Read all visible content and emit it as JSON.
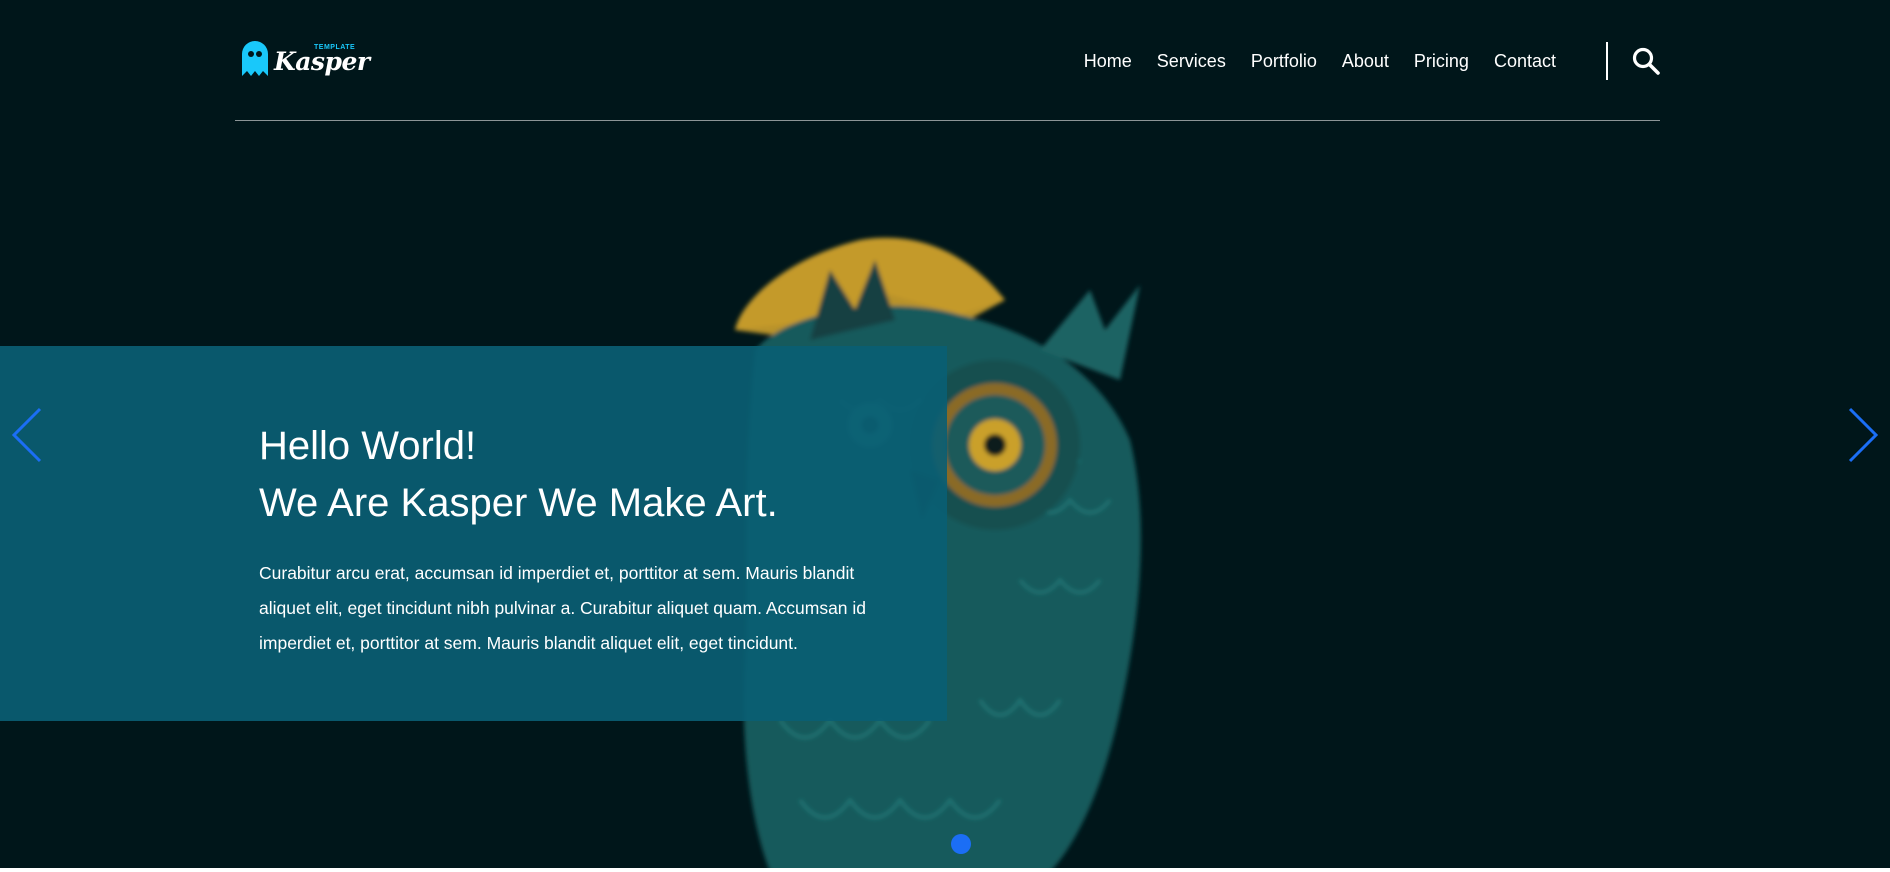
{
  "header": {
    "logo": {
      "word": "Kasper",
      "tag": "TEMPLATE"
    },
    "nav": [
      "Home",
      "Services",
      "Portfolio",
      "About",
      "Pricing",
      "Contact"
    ],
    "search_icon": "search-icon"
  },
  "slider": {
    "title_line_1": "Hello World!",
    "title_line_2": "We Are Kasper We Make Art.",
    "paragraph": "Curabitur arcu erat, accumsan id imperdiet et, porttitor at sem. Mauris blandit aliquet elit, eget tincidunt nibh pulvinar a. Curabitur aliquet quam. Accumsan id imperdiet et, porttitor at sem. Mauris blandit aliquet elit, eget tincidunt.",
    "prev_icon": "chevron-left-icon",
    "next_icon": "chevron-right-icon",
    "active_slide": 1
  },
  "colors": {
    "background": "#00161a",
    "panel": "#0a5e73",
    "accent": "#1b6ef5",
    "logo_blue": "#19c8fa",
    "moon": "#c49a2a",
    "owl": "#1f6e6e"
  }
}
